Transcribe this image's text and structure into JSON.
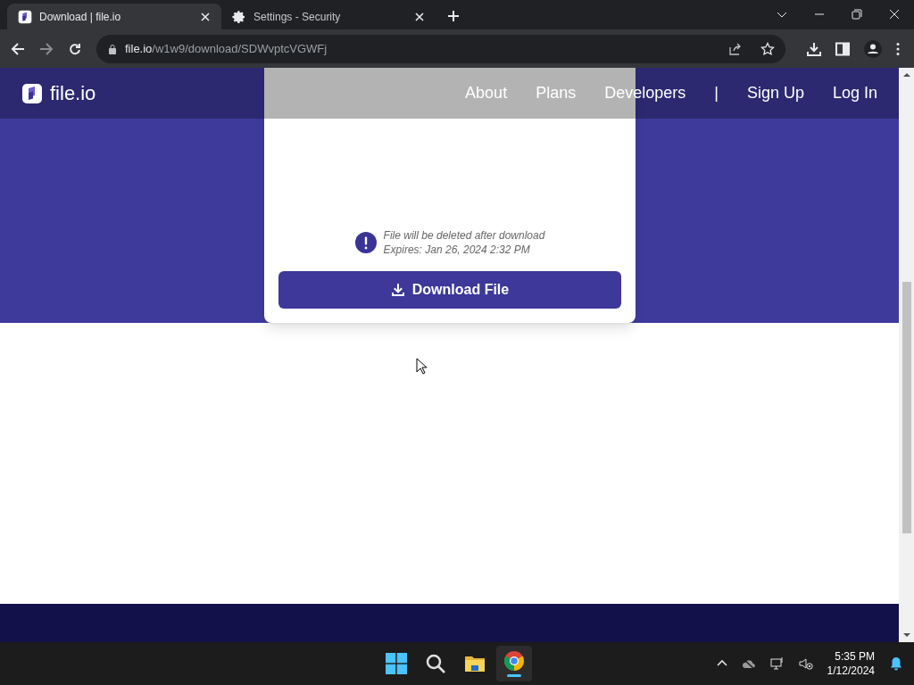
{
  "browser": {
    "tabs": [
      {
        "title": "Download | file.io",
        "kind": "site",
        "selected": true
      },
      {
        "title": "Settings - Security",
        "kind": "settings",
        "selected": false
      }
    ],
    "address": {
      "host": "file.io",
      "path": "/w1w9/download/SDWvptcVGWFj"
    }
  },
  "site": {
    "logo": "file.io",
    "nav": [
      "About",
      "Plans",
      "Developers",
      "|",
      "Sign Up",
      "Log In"
    ],
    "card": {
      "notice": "File will be deleted after download",
      "expires": "Expires: Jan 26, 2024 2:32 PM",
      "button": "Download File"
    }
  },
  "taskbar": {
    "time": "5:35 PM",
    "date": "1/12/2024"
  }
}
